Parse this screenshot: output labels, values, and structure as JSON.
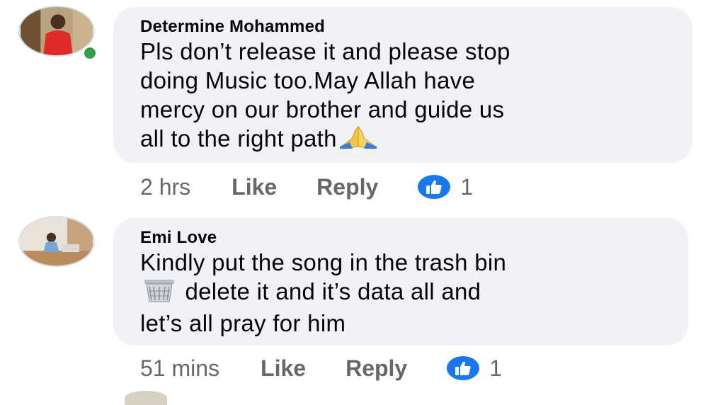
{
  "comments": [
    {
      "author": "Determine Mohammed",
      "lines": [
        "Pls don’t release it and please stop",
        "doing Music too.May Allah have",
        "mercy on our brother and guide us",
        "all to the right path"
      ],
      "emoji": "folded-hands",
      "time": "2 hrs",
      "like_label": "Like",
      "reply_label": "Reply",
      "reaction_count": "1",
      "online": true
    },
    {
      "author": "Emi Love",
      "lines": [
        "Kindly put the song in the trash bin",
        " delete it and it’s data all and",
        "let’s all pray for him"
      ],
      "emoji": "wastebasket",
      "time": "51 mins",
      "like_label": "Like",
      "reply_label": "Reply",
      "reaction_count": "1",
      "online": false
    }
  ],
  "colors": {
    "bubble": "#f0f2f5",
    "meta_text": "#65676b",
    "like_blue": "#1877f2",
    "online_green": "#31a24c"
  }
}
